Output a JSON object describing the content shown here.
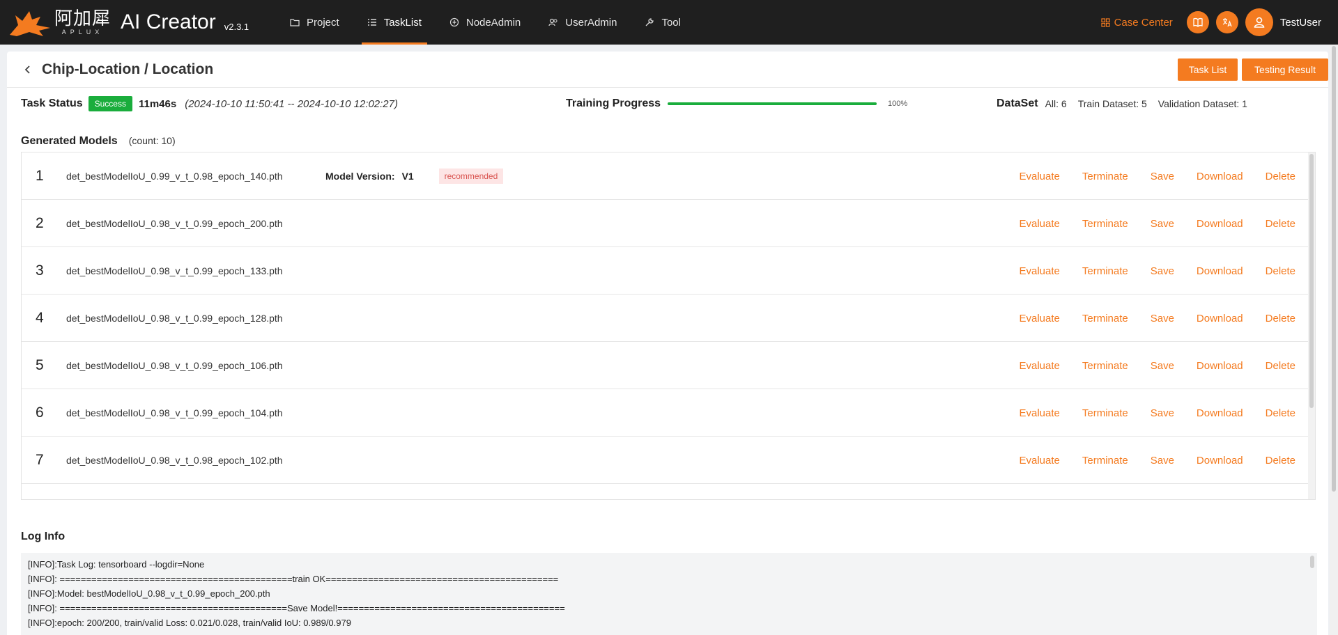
{
  "nav": {
    "brand_cn": "阿加犀",
    "brand_en": "APLUX",
    "app_name": "AI Creator",
    "version": "v2.3.1",
    "items": [
      {
        "label": "Project",
        "icon": "folder-icon"
      },
      {
        "label": "TaskList",
        "icon": "list-icon"
      },
      {
        "label": "NodeAdmin",
        "icon": "node-icon"
      },
      {
        "label": "UserAdmin",
        "icon": "users-icon"
      },
      {
        "label": "Tool",
        "icon": "wrench-icon"
      }
    ],
    "case_center": "Case Center",
    "username": "TestUser",
    "accent": "#f47b20"
  },
  "header": {
    "title": "Chip-Location / Location",
    "task_list_btn": "Task List",
    "testing_result_btn": "Testing Result"
  },
  "status": {
    "label": "Task Status",
    "badge": "Success",
    "duration": "11m46s",
    "range": "(2024-10-10 11:50:41 -- 2024-10-10 12:02:27)",
    "progress_label": "Training Progress",
    "progress_pct": "100%",
    "progress_value": 1.0,
    "dataset_label": "DataSet",
    "all": "All: 6",
    "train": "Train Dataset: 5",
    "validation": "Validation Dataset: 1"
  },
  "models": {
    "title": "Generated Models",
    "count": "(count:  10)",
    "version_label": "Model Version:",
    "actions": {
      "evaluate": "Evaluate",
      "terminate": "Terminate",
      "save": "Save",
      "download": "Download",
      "delete": "Delete"
    },
    "rows": [
      {
        "index": "1",
        "name": "det_bestModelIoU_0.99_v_t_0.98_epoch_140.pth",
        "version": "V1",
        "tag": "recommended"
      },
      {
        "index": "2",
        "name": "det_bestModelIoU_0.98_v_t_0.99_epoch_200.pth"
      },
      {
        "index": "3",
        "name": "det_bestModelIoU_0.98_v_t_0.99_epoch_133.pth"
      },
      {
        "index": "4",
        "name": "det_bestModelIoU_0.98_v_t_0.99_epoch_128.pth"
      },
      {
        "index": "5",
        "name": "det_bestModelIoU_0.98_v_t_0.99_epoch_106.pth"
      },
      {
        "index": "6",
        "name": "det_bestModelIoU_0.98_v_t_0.99_epoch_104.pth"
      },
      {
        "index": "7",
        "name": "det_bestModelIoU_0.98_v_t_0.98_epoch_102.pth"
      }
    ]
  },
  "log": {
    "title": "Log Info",
    "lines": [
      "[INFO]:Task Log: tensorboard --logdir=None",
      "[INFO]: ============================================train OK============================================",
      "[INFO]:Model: bestModelIoU_0.98_v_t_0.99_epoch_200.pth",
      "[INFO]: ===========================================Save Model!===========================================",
      "[INFO]:epoch: 200/200, train/valid Loss: 0.021/0.028, train/valid IoU: 0.989/0.979"
    ]
  }
}
